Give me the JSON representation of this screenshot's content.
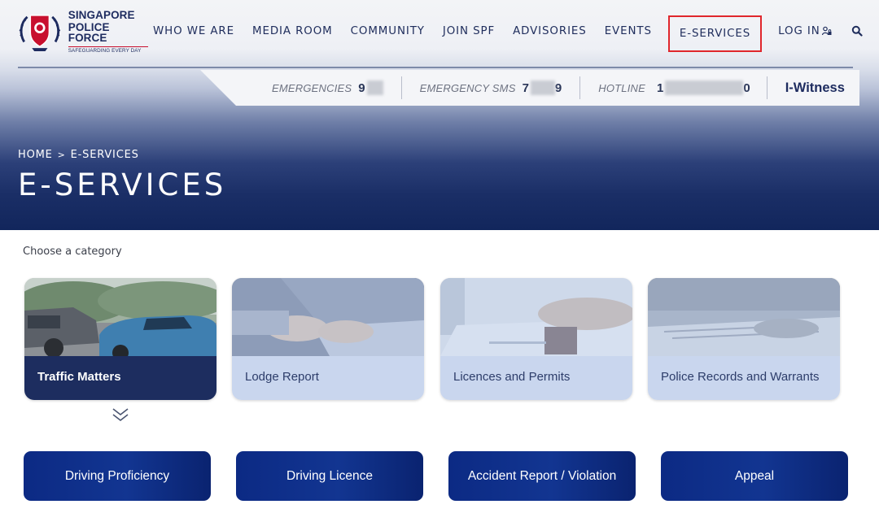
{
  "logo": {
    "line1": "SINGAPORE",
    "line2": "POLICE FORCE",
    "tagline": "SAFEGUARDING EVERY DAY"
  },
  "nav": {
    "items": [
      {
        "label": "WHO WE ARE"
      },
      {
        "label": "MEDIA ROOM"
      },
      {
        "label": "COMMUNITY"
      },
      {
        "label": "JOIN SPF"
      },
      {
        "label": "ADVISORIES"
      },
      {
        "label": "EVENTS"
      },
      {
        "label": "E-SERVICES"
      },
      {
        "label": "LOG IN"
      }
    ],
    "highlight_color": "#e0262c"
  },
  "hotlines": {
    "emergencies_label": "EMERGENCIES",
    "emergencies_value": "9",
    "sms_label": "EMERGENCY SMS",
    "sms_value_start": "7",
    "sms_value_end": "9",
    "hotline_label": "HOTLINE",
    "hotline_value_start": "1",
    "hotline_value_end": "0",
    "iwitness": "I-Witness"
  },
  "breadcrumb": {
    "home": "HOME",
    "separator": ">",
    "current": "E-SERVICES"
  },
  "page": {
    "title": "E-SERVICES",
    "choose_category": "Choose a category"
  },
  "categories": [
    {
      "label": "Traffic Matters",
      "state": "selected"
    },
    {
      "label": "Lodge Report"
    },
    {
      "label": "Licences and Permits"
    },
    {
      "label": "Police Records and Warrants"
    }
  ],
  "services": [
    {
      "label": "Driving Proficiency"
    },
    {
      "label": "Driving Licence"
    },
    {
      "label": "Accident Report / Violation"
    },
    {
      "label": "Appeal"
    }
  ],
  "colors": {
    "brand_navy": "#1d2b5f",
    "button_blue": "#123591",
    "selected_card": "#1d2d5f",
    "inactive_card": "#c9d6ee"
  }
}
